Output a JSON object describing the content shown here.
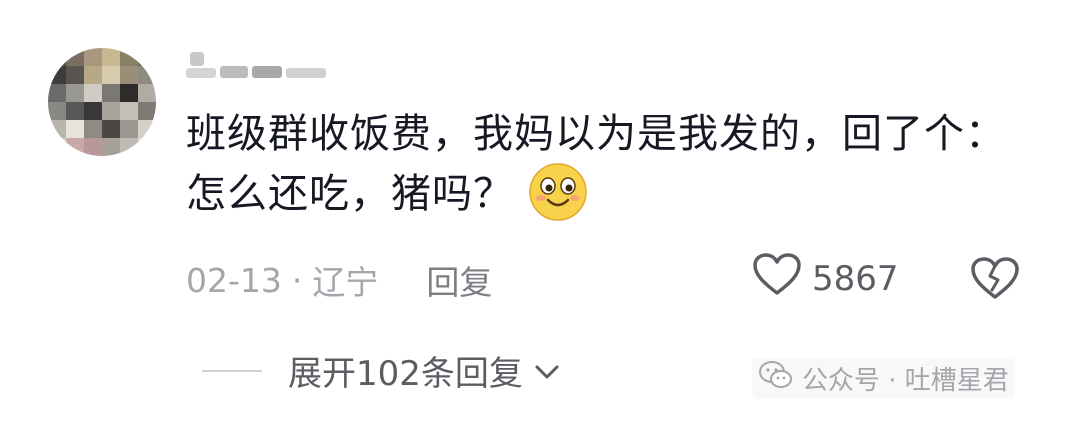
{
  "comment": {
    "text": "班级群收饭费，我妈以为是我发的，回了个：怎么还吃，猪吗？",
    "emoji": "smile-emoji"
  },
  "meta": {
    "date": "02-13",
    "separator": "·",
    "location": "辽宁",
    "reply_label": "回复"
  },
  "like": {
    "count": "5867"
  },
  "expand": {
    "label": "展开102条回复"
  },
  "watermark": {
    "text": "公众号 · 吐槽星君"
  },
  "colors": {
    "text": "#161823",
    "meta": "#a4a6ab",
    "icon": "#5b5d63",
    "emoji_face": "#f8d24a"
  }
}
